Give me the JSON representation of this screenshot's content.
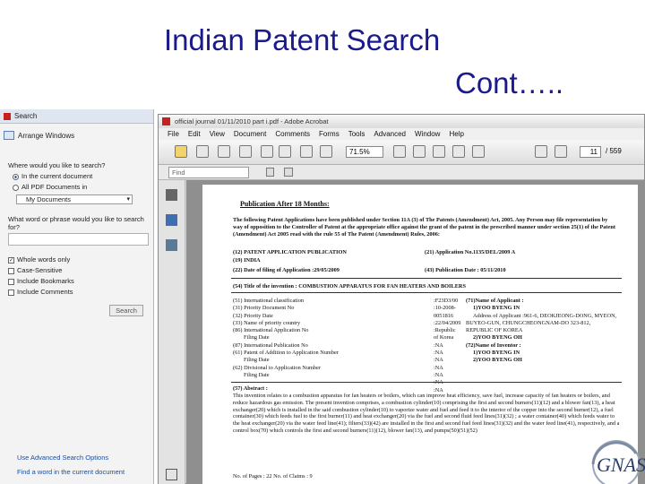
{
  "slide": {
    "title_line1": "Indian Patent Search",
    "title_line2": "Cont….."
  },
  "search_pane": {
    "window_title": "Search",
    "arrange_windows": "Arrange Windows",
    "where_label": "Where would you like to search?",
    "option_current": "In the current document",
    "option_all": "All PDF Documents in",
    "location_value": "My Documents",
    "word_label": "What word or phrase would you like to search for?",
    "search_value": "",
    "check_whole": "Whole words only",
    "check_case": "Case-Sensitive",
    "check_bookmarks": "Include Bookmarks",
    "check_comments": "Include Comments",
    "search_button": "Search",
    "link_advanced": "Use Advanced Search Options",
    "link_find": "Find a word in the current document"
  },
  "acrobat": {
    "window_title": "official journal 01/11/2010 part i.pdf - Adobe Acrobat",
    "menus": [
      "File",
      "Edit",
      "View",
      "Document",
      "Comments",
      "Forms",
      "Tools",
      "Advanced",
      "Window",
      "Help"
    ],
    "zoom": "71.5%",
    "current_page": "11",
    "total_pages": "/ 559",
    "find_placeholder": "Find"
  },
  "document": {
    "heading": "Publication After 18 Months:",
    "intro": "The following Patent Applications have been published under Section 11A (3) of The Patents (Amendment) Act, 2005. Any Person may file representation by way of opposition to the Controller of Patent at the appropriate office against the grant of the patent in the prescribed manner under section 25(1) of the Patent (Amendment) Act 2005 read with the rule 55 of The Patent (Amendment) Rules, 2006:",
    "line12": "(12) PATENT APPLICATION PUBLICATION",
    "line21": "(21) Application No.1135/DEL/2009 A",
    "line19": "(19) INDIA",
    "line22": "(22) Date of filing of Application :29/05/2009",
    "line43": "(43) Publication Date : 05/11/2010",
    "line54": "(54) Title of the invention : COMBUSTION APPARATUS FOR FAN HEATERS AND BOILERS",
    "fields": [
      "(51) International classification",
      "(31) Priority Document No",
      "(32) Priority Date",
      "(33) Name of priority country",
      "(86) International Application No",
      "Filing Date",
      "(87) International Publication No",
      "(61) Patent of Addition to Application Number",
      "Filing Date",
      "(62) Divisional to Application Number",
      "Filing Date"
    ],
    "values": [
      ":F23D3/00",
      ":10-2008-",
      "0051816",
      ":22/04/2009",
      ":Republic",
      "of Korea",
      ":NA",
      ":NA",
      ":NA",
      ":NA",
      ":NA",
      ":NA",
      ":NA"
    ],
    "applicants": [
      "(71)Name of Applicant :",
      "1)YOO BYENG IN",
      "Address of Applicant :961-6, DEOKJEONG-DONG, MYEON,",
      "BUYEO-GUN, CHUNGCHEONGNAM-DO 323-812,",
      "REPUBLIC OF KOREA",
      "2)YOO BYENG OH",
      "(72)Name of Inventor :",
      "1)YOO BYENG IN",
      "2)YOO BYENG OH"
    ],
    "abstract_title": "(57) Abstract :",
    "abstract": "This invention relates to a combustion apparatus for fan heaters or boilers, which can improve heat efficiency, save fuel, increase capacity of fan heaters or boilers, and reduce hazardous gas emission. The present invention comprises, a combustion cylinder(10) comprising the first and second burners(11)(12) and a blower fan(13), a heat exchanger(20) which is installed in the said combustion cylinder(10) to vaporize water and fuel and feed it to the interior of the copper into the second burner(12), a fuel container(30) which feeds fuel to the first burner(11) and heat exchanger(20) via the fuel and second fluid feed lines(31)(32) ; a water container(40) which feeds water to the heat exchanger(20) via the water feed line(41); filters(33)(42) are installed in the first and second fuel feed lines(31)(32) and the water feed line(41), respectively, and a control box(70) which controls the first and second burners(11)(12), blower fan(13), and pumps(50)(51)(52)",
    "footer": "No. of Pages : 22   No. of Claims : 9"
  },
  "logo": {
    "text": "GNAS"
  }
}
